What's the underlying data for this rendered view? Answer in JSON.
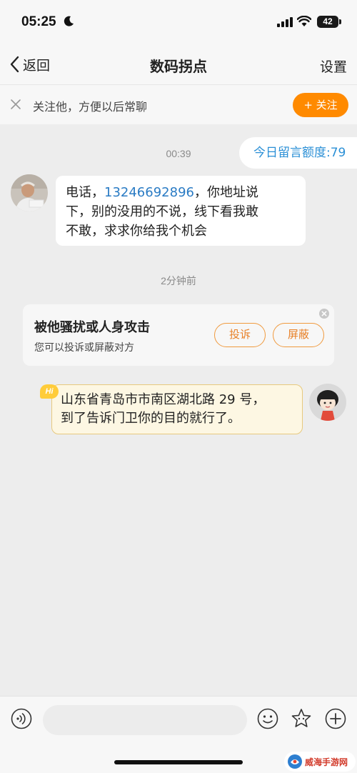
{
  "status_bar": {
    "time": "05:25",
    "battery": "42"
  },
  "nav": {
    "back_label": "返回",
    "title": "数码拐点",
    "settings_label": "设置"
  },
  "follow_bar": {
    "text": "关注他，方便以后常聊",
    "button_label": "+ 关注"
  },
  "quota": {
    "label": "今日留言额度:79"
  },
  "messages": {
    "timestamp_1": "00:39",
    "incoming": {
      "text_before": "电话，",
      "phone": "13246692896",
      "line_1_after": "，你地址说",
      "line_2": "下，别的没用的不说，线下看我敢",
      "line_3": "不敢，求求你给我个机会"
    },
    "timestamp_2": "2分钟前",
    "outgoing": {
      "badge": "Hi",
      "line_1": "山东省青岛市市南区湖北路 29 号，",
      "line_2": "到了告诉门卫你的目的就行了。"
    }
  },
  "report_card": {
    "title": "被他骚扰或人身攻击",
    "subtitle": "您可以投诉或屏蔽对方",
    "report_label": "投诉",
    "block_label": "屏蔽"
  },
  "input_bar": {
    "placeholder": ""
  },
  "watermark": {
    "text": "威海手游网"
  },
  "colors": {
    "accent": "#ff8a00",
    "link": "#2a8fd6",
    "background": "#ededed"
  }
}
